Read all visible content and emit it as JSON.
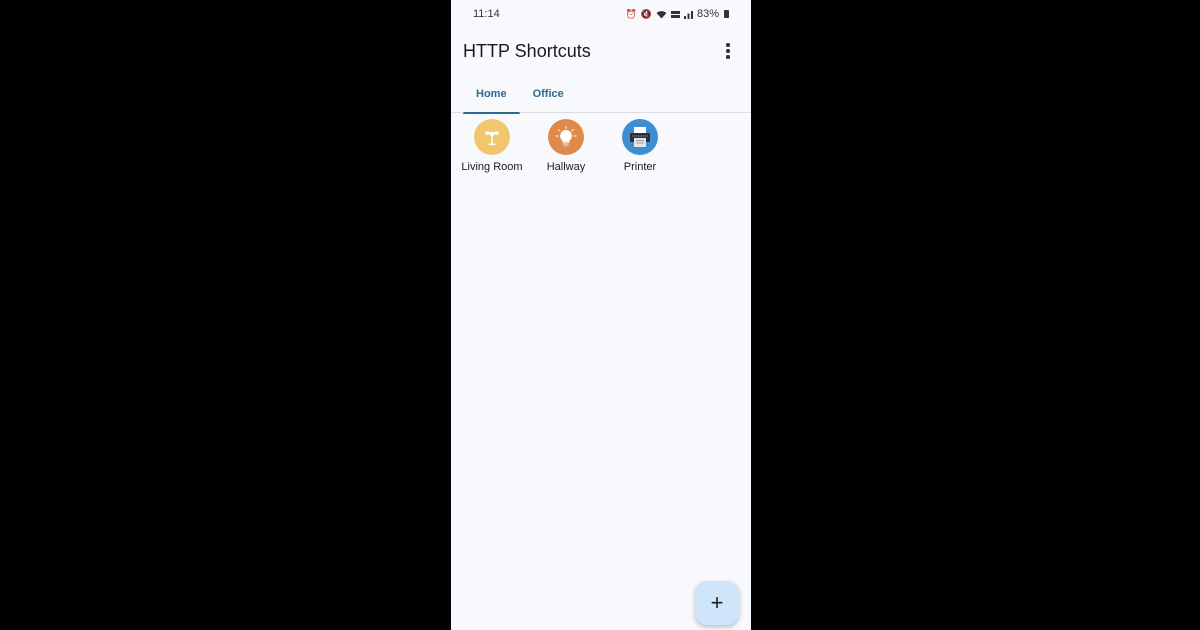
{
  "status_bar": {
    "time": "11:14",
    "battery_percent": "83%",
    "icons": [
      "alarm-icon",
      "mute-icon",
      "wifi-icon",
      "volte-icon",
      "signal-icon",
      "battery-icon"
    ]
  },
  "app_bar": {
    "title": "HTTP Shortcuts",
    "menu_icon": "more-vert-icon"
  },
  "tabs": [
    {
      "label": "Home",
      "active": true
    },
    {
      "label": "Office",
      "active": false
    }
  ],
  "shortcuts": [
    {
      "label": "Living Room",
      "icon": "fan-icon",
      "color": "#f2c66d"
    },
    {
      "label": "Hallway",
      "icon": "lightbulb-icon",
      "color": "#e08a4a"
    },
    {
      "label": "Printer",
      "icon": "printer-icon",
      "color": "#3d8fd1"
    }
  ],
  "fab": {
    "icon": "plus-icon",
    "label": "+"
  },
  "colors": {
    "accent": "#2e6a8e",
    "fab_background": "#cfe5fa",
    "screen_background": "#f8f9fc"
  }
}
